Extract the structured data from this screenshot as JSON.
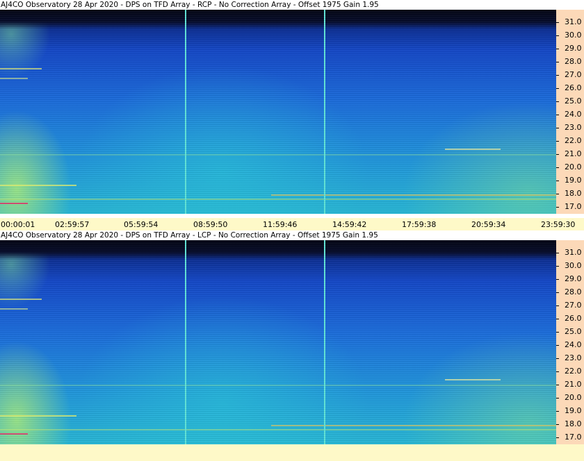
{
  "panels": [
    {
      "title": "AJ4CO Observatory 28 Apr 2020 - DPS on TFD Array  - RCP  -  No Correction Array  -  Offset 1975  Gain 1.95",
      "polarization": "RCP"
    },
    {
      "title": "AJ4CO Observatory 28 Apr 2020 - DPS on TFD Array  - LCP  -  No Correction Array  -  Offset 1975  Gain 1.95",
      "polarization": "LCP"
    }
  ],
  "frequency_labels": [
    "31.0",
    "30.0",
    "29.0",
    "28.0",
    "27.0",
    "26.0",
    "25.0",
    "24.0",
    "23.0",
    "22.0",
    "21.0",
    "20.0",
    "19.0",
    "18.0",
    "17.0"
  ],
  "time_labels": [
    "00:00:01",
    "02:59:57",
    "05:59:54",
    "08:59:50",
    "11:59:46",
    "14:59:42",
    "17:59:38",
    "20:59:34",
    "23:59:30"
  ],
  "colors": {
    "cursor": "#5fe3d6",
    "scale_background": "#fcd9b8",
    "time_axis_background": "#fef9c8"
  }
}
